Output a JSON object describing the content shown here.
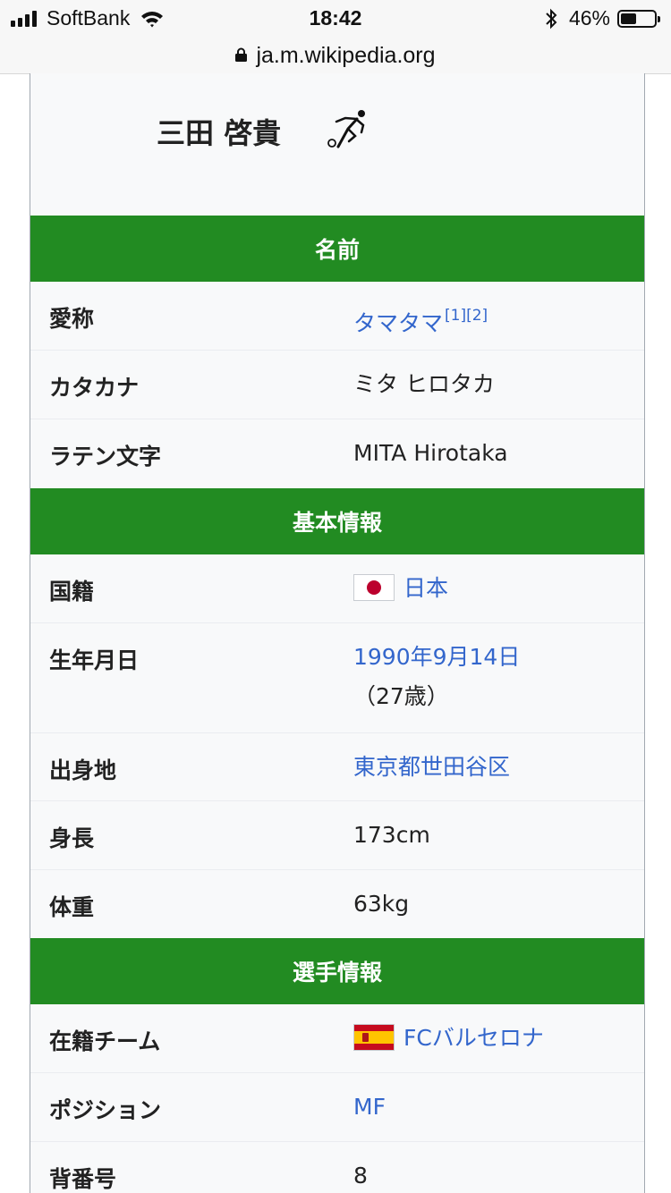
{
  "status_bar": {
    "carrier": "SoftBank",
    "time": "18:42",
    "battery_text": "46%",
    "battery_level": 0.46
  },
  "url_bar": {
    "url": "ja.m.wikipedia.org"
  },
  "infobox": {
    "player_name": "三田 啓貴",
    "sections": [
      {
        "header": "名前",
        "rows": [
          {
            "label": "愛称",
            "value": "タマタマ",
            "refs": "[1][2]"
          },
          {
            "label": "カタカナ",
            "value": "ミタ ヒロタカ"
          },
          {
            "label": "ラテン文字",
            "value": "MITA Hirotaka"
          }
        ]
      },
      {
        "header": "基本情報",
        "rows": [
          {
            "label": "国籍",
            "value": "日本"
          },
          {
            "label": "生年月日",
            "value_link": "1990年9月14日",
            "value_rest": "（27歳）"
          },
          {
            "label": "出身地",
            "value": "東京都世田谷区"
          },
          {
            "label": "身長",
            "value": "173cm"
          },
          {
            "label": "体重",
            "value": "63kg"
          }
        ]
      },
      {
        "header": "選手情報",
        "rows": [
          {
            "label": "在籍チーム",
            "value": "FCバルセロナ"
          },
          {
            "label": "ポジション",
            "value": "MF"
          },
          {
            "label": "背番号",
            "value": "8"
          }
        ]
      }
    ]
  },
  "colors": {
    "section_header_bg": "#228b22",
    "link": "#3366cc",
    "infobox_bg": "#f8f9fa"
  },
  "icons": [
    "signal-bars-icon",
    "wifi-icon",
    "bluetooth-icon",
    "battery-icon",
    "lock-icon",
    "soccer-player-icon",
    "japan-flag-icon",
    "spain-flag-icon"
  ]
}
